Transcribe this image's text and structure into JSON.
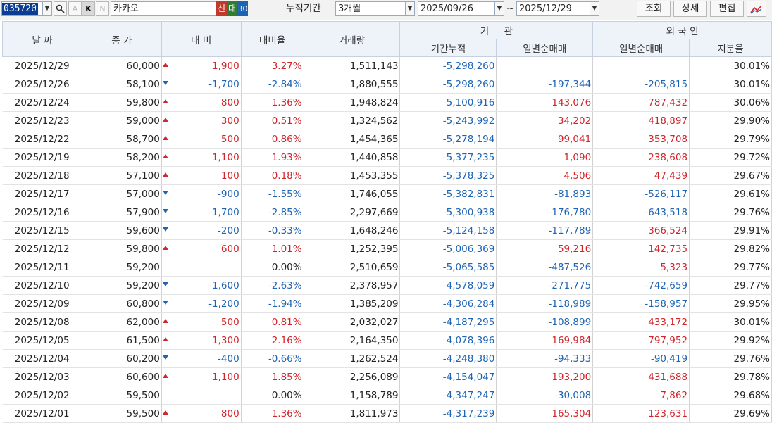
{
  "toolbar": {
    "code": "035720",
    "dropdown_glyph": "▼",
    "btn_a": "A",
    "btn_k": "K",
    "btn_n": "N",
    "stock_name": "카카오",
    "badge_shin": "신",
    "badge_dae": "대",
    "badge_30": "30",
    "period_label": "누적기간",
    "period_value": "3개월",
    "start_date": "2025/09/26",
    "tilde": "~",
    "end_date": "2025/12/29",
    "search_label": "조회",
    "detail_label": "상세",
    "edit_label": "편집"
  },
  "headers": {
    "date": "날 짜",
    "close": "종 가",
    "diff": "대 비",
    "rate": "대비율",
    "volume": "거래량",
    "inst_group": "기     관",
    "inst_cum": "기간누적",
    "inst_daily": "일별순매매",
    "foreign_group": "외 국 인",
    "foreign_daily": "일별순매매",
    "foreign_share": "지분율"
  },
  "colors": {
    "up": "#d2252b",
    "down": "#1f64b4",
    "header_bg": "#eef3fa",
    "code_bg": "#0a3d91",
    "badge_red": "#c0392b",
    "badge_green": "#2e7d32",
    "badge_blue": "#1f64b4"
  },
  "rows": [
    {
      "date": "2025/12/29",
      "close": "60,000",
      "dir": "up",
      "diff": "1,900",
      "rate": "3.27%",
      "volume": "1,511,143",
      "inst_cum": "-5,298,260",
      "inst_daily": "",
      "foreign_daily": "",
      "foreign_share": "30.01%"
    },
    {
      "date": "2025/12/26",
      "close": "58,100",
      "dir": "down",
      "diff": "-1,700",
      "rate": "-2.84%",
      "volume": "1,880,555",
      "inst_cum": "-5,298,260",
      "inst_daily": "-197,344",
      "foreign_daily": "-205,815",
      "foreign_share": "30.01%"
    },
    {
      "date": "2025/12/24",
      "close": "59,800",
      "dir": "up",
      "diff": "800",
      "rate": "1.36%",
      "volume": "1,948,824",
      "inst_cum": "-5,100,916",
      "inst_daily": "143,076",
      "foreign_daily": "787,432",
      "foreign_share": "30.06%"
    },
    {
      "date": "2025/12/23",
      "close": "59,000",
      "dir": "up",
      "diff": "300",
      "rate": "0.51%",
      "volume": "1,324,562",
      "inst_cum": "-5,243,992",
      "inst_daily": "34,202",
      "foreign_daily": "418,897",
      "foreign_share": "29.90%"
    },
    {
      "date": "2025/12/22",
      "close": "58,700",
      "dir": "up",
      "diff": "500",
      "rate": "0.86%",
      "volume": "1,454,365",
      "inst_cum": "-5,278,194",
      "inst_daily": "99,041",
      "foreign_daily": "353,708",
      "foreign_share": "29.79%"
    },
    {
      "date": "2025/12/19",
      "close": "58,200",
      "dir": "up",
      "diff": "1,100",
      "rate": "1.93%",
      "volume": "1,440,858",
      "inst_cum": "-5,377,235",
      "inst_daily": "1,090",
      "foreign_daily": "238,608",
      "foreign_share": "29.72%"
    },
    {
      "date": "2025/12/18",
      "close": "57,100",
      "dir": "up",
      "diff": "100",
      "rate": "0.18%",
      "volume": "1,453,355",
      "inst_cum": "-5,378,325",
      "inst_daily": "4,506",
      "foreign_daily": "47,439",
      "foreign_share": "29.67%"
    },
    {
      "date": "2025/12/17",
      "close": "57,000",
      "dir": "down",
      "diff": "-900",
      "rate": "-1.55%",
      "volume": "1,746,055",
      "inst_cum": "-5,382,831",
      "inst_daily": "-81,893",
      "foreign_daily": "-526,117",
      "foreign_share": "29.61%"
    },
    {
      "date": "2025/12/16",
      "close": "57,900",
      "dir": "down",
      "diff": "-1,700",
      "rate": "-2.85%",
      "volume": "2,297,669",
      "inst_cum": "-5,300,938",
      "inst_daily": "-176,780",
      "foreign_daily": "-643,518",
      "foreign_share": "29.76%"
    },
    {
      "date": "2025/12/15",
      "close": "59,600",
      "dir": "down",
      "diff": "-200",
      "rate": "-0.33%",
      "volume": "1,648,246",
      "inst_cum": "-5,124,158",
      "inst_daily": "-117,789",
      "foreign_daily": "366,524",
      "foreign_share": "29.91%"
    },
    {
      "date": "2025/12/12",
      "close": "59,800",
      "dir": "up",
      "diff": "600",
      "rate": "1.01%",
      "volume": "1,252,395",
      "inst_cum": "-5,006,369",
      "inst_daily": "59,216",
      "foreign_daily": "142,735",
      "foreign_share": "29.82%"
    },
    {
      "date": "2025/12/11",
      "close": "59,200",
      "dir": "none",
      "diff": "",
      "rate": "0.00%",
      "volume": "2,510,659",
      "inst_cum": "-5,065,585",
      "inst_daily": "-487,526",
      "foreign_daily": "5,323",
      "foreign_share": "29.77%"
    },
    {
      "date": "2025/12/10",
      "close": "59,200",
      "dir": "down",
      "diff": "-1,600",
      "rate": "-2.63%",
      "volume": "2,378,957",
      "inst_cum": "-4,578,059",
      "inst_daily": "-271,775",
      "foreign_daily": "-742,659",
      "foreign_share": "29.77%"
    },
    {
      "date": "2025/12/09",
      "close": "60,800",
      "dir": "down",
      "diff": "-1,200",
      "rate": "-1.94%",
      "volume": "1,385,209",
      "inst_cum": "-4,306,284",
      "inst_daily": "-118,989",
      "foreign_daily": "-158,957",
      "foreign_share": "29.95%"
    },
    {
      "date": "2025/12/08",
      "close": "62,000",
      "dir": "up",
      "diff": "500",
      "rate": "0.81%",
      "volume": "2,032,027",
      "inst_cum": "-4,187,295",
      "inst_daily": "-108,899",
      "foreign_daily": "433,172",
      "foreign_share": "30.01%"
    },
    {
      "date": "2025/12/05",
      "close": "61,500",
      "dir": "up",
      "diff": "1,300",
      "rate": "2.16%",
      "volume": "2,164,350",
      "inst_cum": "-4,078,396",
      "inst_daily": "169,984",
      "foreign_daily": "797,952",
      "foreign_share": "29.92%"
    },
    {
      "date": "2025/12/04",
      "close": "60,200",
      "dir": "down",
      "diff": "-400",
      "rate": "-0.66%",
      "volume": "1,262,524",
      "inst_cum": "-4,248,380",
      "inst_daily": "-94,333",
      "foreign_daily": "-90,419",
      "foreign_share": "29.76%"
    },
    {
      "date": "2025/12/03",
      "close": "60,600",
      "dir": "up",
      "diff": "1,100",
      "rate": "1.85%",
      "volume": "2,256,089",
      "inst_cum": "-4,154,047",
      "inst_daily": "193,200",
      "foreign_daily": "431,688",
      "foreign_share": "29.78%"
    },
    {
      "date": "2025/12/02",
      "close": "59,500",
      "dir": "none",
      "diff": "",
      "rate": "0.00%",
      "volume": "1,158,789",
      "inst_cum": "-4,347,247",
      "inst_daily": "-30,008",
      "foreign_daily": "7,862",
      "foreign_share": "29.68%"
    },
    {
      "date": "2025/12/01",
      "close": "59,500",
      "dir": "up",
      "diff": "800",
      "rate": "1.36%",
      "volume": "1,811,973",
      "inst_cum": "-4,317,239",
      "inst_daily": "165,304",
      "foreign_daily": "123,631",
      "foreign_share": "29.69%"
    }
  ]
}
